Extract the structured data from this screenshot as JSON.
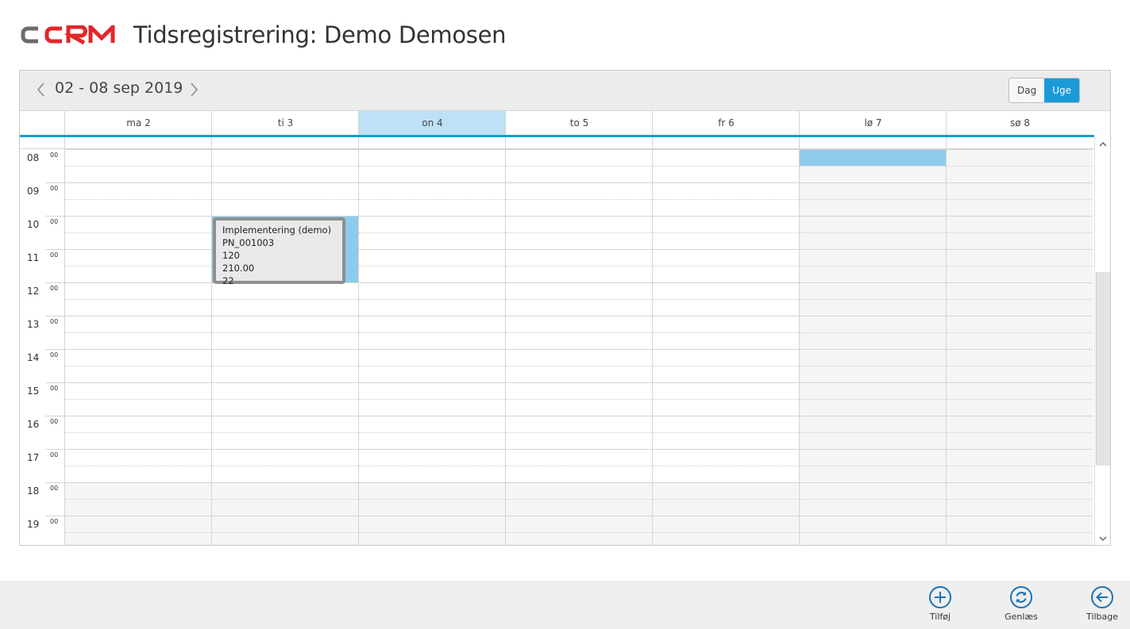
{
  "header": {
    "logo_text": "CCRM",
    "title": "Tidsregistrering: Demo Demosen"
  },
  "toolbar": {
    "range_label": "02 - 08 sep 2019",
    "views": [
      {
        "label": "Dag",
        "active": false
      },
      {
        "label": "Uge",
        "active": true
      }
    ]
  },
  "days": [
    {
      "label": "ma 2",
      "today": false,
      "weekend": false
    },
    {
      "label": "ti 3",
      "today": false,
      "weekend": false
    },
    {
      "label": "on 4",
      "today": true,
      "weekend": false
    },
    {
      "label": "to 5",
      "today": false,
      "weekend": false
    },
    {
      "label": "fr 6",
      "today": false,
      "weekend": false
    },
    {
      "label": "lø 7",
      "today": false,
      "weekend": true
    },
    {
      "label": "sø 8",
      "today": false,
      "weekend": true
    }
  ],
  "hours": [
    {
      "h": "08",
      "m": "00"
    },
    {
      "h": "09",
      "m": "00"
    },
    {
      "h": "10",
      "m": "00"
    },
    {
      "h": "11",
      "m": "00"
    },
    {
      "h": "12",
      "m": "00"
    },
    {
      "h": "13",
      "m": "00"
    },
    {
      "h": "14",
      "m": "00"
    },
    {
      "h": "15",
      "m": "00"
    },
    {
      "h": "16",
      "m": "00"
    },
    {
      "h": "17",
      "m": "00"
    },
    {
      "h": "18",
      "m": "00"
    },
    {
      "h": "19",
      "m": "00"
    }
  ],
  "event": {
    "title": "Implementering (demo)",
    "project": "PN_001003",
    "line3": "120",
    "line4": "210.00",
    "line5": "22"
  },
  "footer": {
    "add_label": "Tilføj",
    "reload_label": "Genlæs",
    "back_label": "Tilbage"
  },
  "colors": {
    "accent": "#1a9bd7",
    "today": "#bde1f5",
    "event": "#8dcbec",
    "logo_red": "#e3262b",
    "logo_gray": "#6b6b6b"
  }
}
